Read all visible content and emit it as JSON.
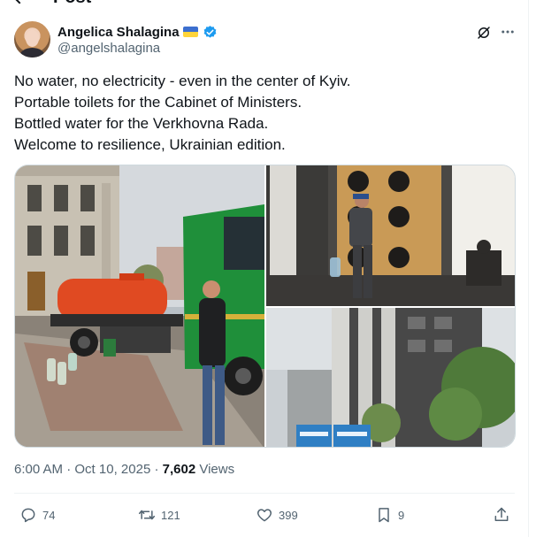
{
  "header": {
    "title": "Post"
  },
  "author": {
    "display_name": "Angelica Shalagina",
    "handle": "@angelshalagina",
    "flag_icon": "ukraine-flag-emoji",
    "verified_icon": "verified-badge-icon",
    "verified_color": "#1d9bf0"
  },
  "tweet": {
    "lines": [
      "No water, no electricity - even in the center of Kyiv.",
      "Portable toilets for the Cabinet of Ministers.",
      "Bottled water for the Verkhovna Rada.",
      "Welcome to resilience, Ukrainian edition."
    ]
  },
  "media": {
    "count": 3,
    "photos": [
      {
        "name": "water-truck-photo"
      },
      {
        "name": "verkhovna-rada-door-photo"
      },
      {
        "name": "portable-toilets-photo"
      }
    ]
  },
  "meta": {
    "time": "6:00 AM",
    "separator": "·",
    "date": "Oct 10, 2025",
    "separator2": "·",
    "views_count": "7,602",
    "views_label": "Views"
  },
  "actions": {
    "replies": "74",
    "reposts": "121",
    "likes": "399",
    "bookmarks": "9"
  },
  "colors": {
    "text": "#0f1419",
    "secondary": "#536471",
    "border": "#cfd9de",
    "accent": "#1d9bf0"
  }
}
